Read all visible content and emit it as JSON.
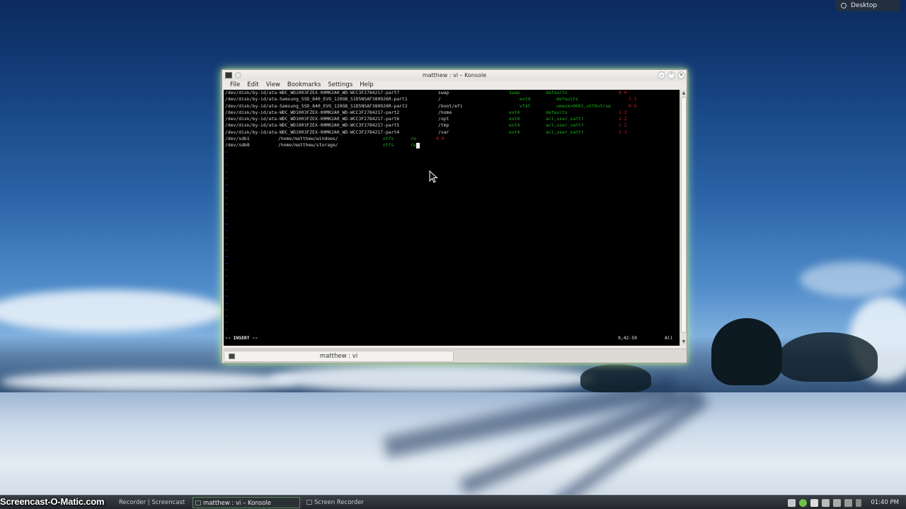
{
  "desktop": {
    "button_label": "Desktop"
  },
  "window": {
    "title": "matthew : vi – Konsole",
    "menu": [
      "File",
      "Edit",
      "View",
      "Bookmarks",
      "Settings",
      "Help"
    ],
    "tab_label": "matthew : vi"
  },
  "terminal": {
    "lines": [
      {
        "dev": "/dev/disk/by-id/ata-WDC_WD1003FZEX-00MK2A0_WD-WCC3F2784217-part7",
        "mount": "swap",
        "type": "swap",
        "opts": "defaults",
        "dump": "0 0"
      },
      {
        "dev": "/dev/disk/by-id/ata-Samsung_SSD_840_EVO_120GB_S1D5NSAF380926R-part1",
        "mount": "/",
        "type": "ext4",
        "opts": "defaults",
        "dump": "1 1"
      },
      {
        "dev": "/dev/disk/by-id/ata-Samsung_SSD_840_EVO_120GB_S1D5NSAF380926R-part2",
        "mount": "/boot/efi",
        "type": "vfat",
        "opts": "umask=0002,utf8=true",
        "dump": "0 0"
      },
      {
        "dev": "/dev/disk/by-id/ata-WDC_WD1003FZEX-00MK2A0_WD-WCC3F2784217-part2",
        "mount": "/home",
        "type": "ext4",
        "opts": "defaults",
        "dump": "1 2"
      },
      {
        "dev": "/dev/disk/by-id/ata-WDC_WD1003FZEX-00MK2A0_WD-WCC3F2784217-part6",
        "mount": "/opt",
        "type": "ext4",
        "opts": "acl,user_xattr",
        "dump": "1 2"
      },
      {
        "dev": "/dev/disk/by-id/ata-WDC_WD1003FZEX-00MK2A0_WD-WCC3F2784217-part5",
        "mount": "/tmp",
        "type": "ext4",
        "opts": "acl,user_xattr",
        "dump": "1 2"
      },
      {
        "dev": "/dev/disk/by-id/ata-WDC_WD1003FZEX-00MK2A0_WD-WCC3F2784217-part4",
        "mount": "/var",
        "type": "ext4",
        "opts": "acl,user_xattr",
        "dump": "1 2"
      },
      {
        "dev": "/dev/sdb1",
        "mount": "/home/matthew/windows/",
        "type": "ntfs",
        "opts": "rw",
        "dump": "0 0"
      },
      {
        "dev": "/dev/sdb8",
        "mount": "/home/matthew/storage/",
        "type": "ntfs",
        "opts": "rw",
        "dump": ""
      }
    ],
    "tilde": "~",
    "mode": "-- INSERT --",
    "position": "9,42-59",
    "scroll": "All"
  },
  "taskbar": {
    "watermark": "Screencast-O-Matic.com",
    "items": [
      "Recorder | Screencast",
      "matthew : vi – Konsole",
      "Screen Recorder"
    ],
    "clock": "01:40 PM"
  }
}
